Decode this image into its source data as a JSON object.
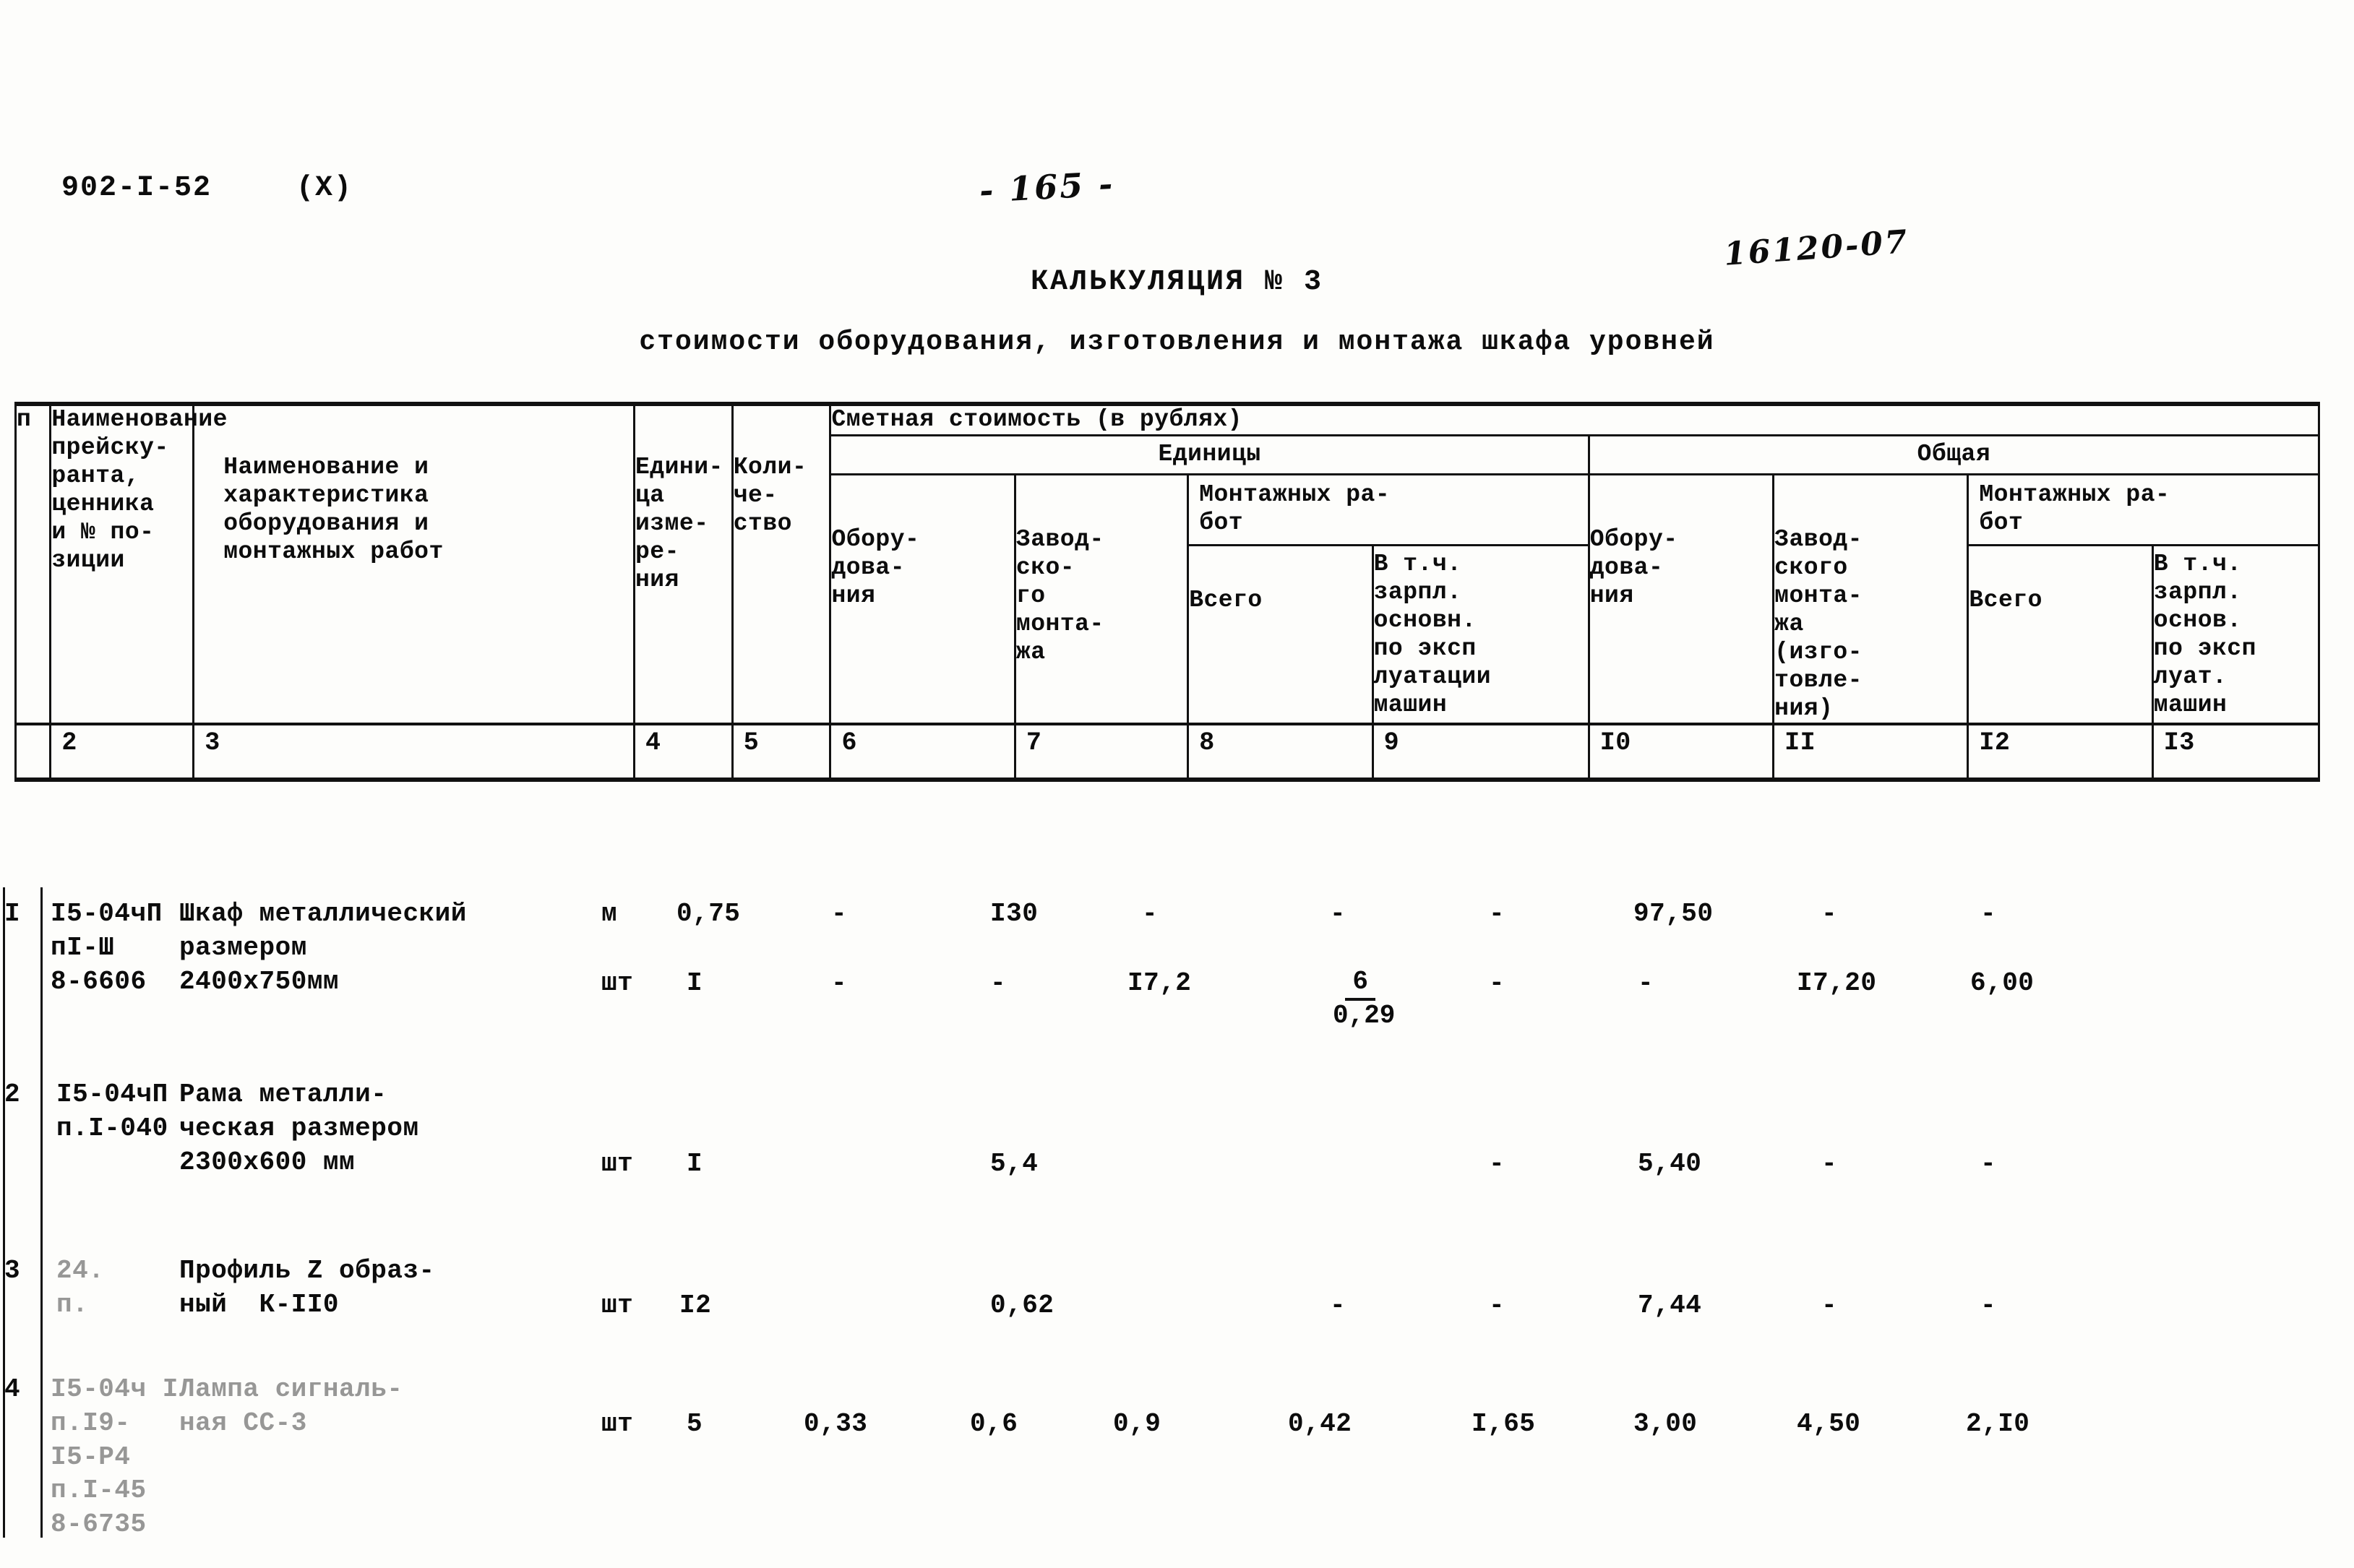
{
  "header": {
    "doc_code": "902-I-52",
    "doc_variant": "(X)",
    "page_number": "- 165 -",
    "order_number": "16120-07",
    "title": "КАЛЬКУЛЯЦИЯ № 3",
    "subtitle": "стоимости оборудования, изготовления и монтажа шкафа уровней"
  },
  "table": {
    "group_top": "Сметная стоимость (в рублях)",
    "group_unit": "Единицы",
    "group_total": "Общая",
    "group_install_unit": "Монтажных ра-\nбот",
    "group_install_total": "Монтажных ра-\nбот",
    "columns": {
      "c1": "п",
      "c2": "Наименование прейску-\nранта,\nценника\nи № по-\nзиции",
      "c3": "Наименование и\nхарактеристика\nоборудования и\nмонтажных работ",
      "c4": "Едини-\nца\nизме-\nре-\nния",
      "c5": "Коли-\nче-\nство",
      "c6": "Обору-\nдова-\nния",
      "c7": "Завод-\nско-\nго\nмонта-\nжа",
      "c8": "Всего",
      "c9": "В т.ч.\nзарпл.\nосновн.\nпо эксп\nлуатации\nмашин",
      "c10": "Обору-\nдова-\nния",
      "c11": "Завод-\nского\nмонта-\nжа\n(изго-\nтовле-\nния)",
      "c12": "Всего",
      "c13": "В т.ч.\nзарпл.\nоснов.\nпо эксп\nлуат.\nмашин"
    },
    "number_row": [
      "2",
      "3",
      "4",
      "5",
      "6",
      "7",
      "8",
      "9",
      "I0",
      "II",
      "I2",
      "I3"
    ]
  },
  "rows": [
    {
      "no": "I",
      "price_ref": "I5-04чП\nпI-Ш\n8-6606",
      "description": "Шкаф металлический\nразмером\n2400х750мм",
      "lineA": {
        "unit": "м",
        "qty": "0,75",
        "c6": "-",
        "c7": "I30",
        "c8": "-",
        "c9": "-",
        "c10": "-",
        "c11": "97,50",
        "c12": "-",
        "c13": "-"
      },
      "lineB": {
        "unit": "шт",
        "qty": "I",
        "c6": "-",
        "c7": "-",
        "c8": "I7,2",
        "c9_num": "6",
        "c9_den": "0,29",
        "c10": "-",
        "c11": "-",
        "c12": "I7,20",
        "c13": "6,00"
      }
    },
    {
      "no": "2",
      "price_ref": "I5-04чП\nп.I-040",
      "description": "Рама металли-\nческая размером\n2300х600 мм",
      "lineA": {
        "unit": "шт",
        "qty": "I",
        "c6": "",
        "c7": "5,4",
        "c8": "",
        "c9": "",
        "c10": "-",
        "c11": "5,40",
        "c12": "-",
        "c13": "-"
      }
    },
    {
      "no": "3",
      "price_ref": "24.\nп.",
      "description": "Профиль Z образ-\nный  К-II0",
      "lineA": {
        "unit": "шт",
        "qty": "I2",
        "c6": "",
        "c7": "0,62",
        "c8": "",
        "c9": "-",
        "c10": "-",
        "c11": "7,44",
        "c12": "-",
        "c13": "-"
      }
    },
    {
      "no": "4",
      "price_ref": "I5-04ч I\nп.I9-\nI5-Р4\nп.I-45\n8-6735",
      "description": "Лампа сигналь-\nная СС-3",
      "lineA": {
        "unit": "шт",
        "qty": "5",
        "c6": "0,33",
        "c7": "0,6",
        "c8": "0,9",
        "c9": "0,42",
        "c10": "I,65",
        "c11": "3,00",
        "c12": "4,50",
        "c13": "2,I0"
      }
    }
  ]
}
